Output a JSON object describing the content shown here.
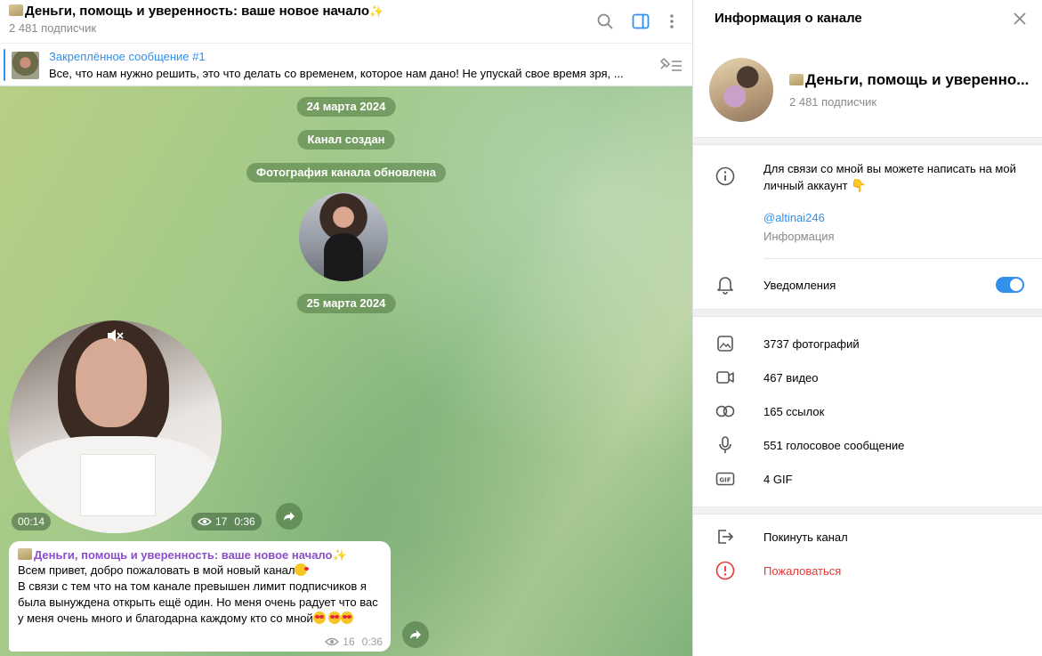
{
  "channel": {
    "title": "Деньги, помощь и уверенность: ваше новое начало",
    "subscribers": "2 481 подписчик"
  },
  "pinned": {
    "title": "Закреплённое сообщение #1",
    "text": "Все, что нам нужно решить, это что делать со временем, которое нам дано!  Не упускай свое время зря, ..."
  },
  "service": {
    "date1": "24 марта 2024",
    "created": "Канал создан",
    "photo_updated": "Фотография канала обновлена",
    "date2": "25 марта 2024"
  },
  "video_message": {
    "elapsed": "00:14",
    "views": "17",
    "time": "0:36"
  },
  "post": {
    "title": "Деньги, помощь и уверенность: ваше новое начало",
    "line1": "Всем привет, добро пожаловать в мой новый канал",
    "line2": "В связи с тем что на том канале превышен лимит подписчиков я была вынуждена открыть ещё один. Но меня очень радует что вас у меня очень много и благодарна каждому кто со мной",
    "views": "16",
    "time": "0:36"
  },
  "info_panel": {
    "header": "Информация о канале",
    "name": "Деньги, помощь и уверенно...",
    "subscribers": "2 481 подписчик",
    "about": "Для связи со мной вы можете написать на мой личный аккаунт",
    "username": "@altinai246",
    "username_caption": "Информация",
    "notifications": "Уведомления",
    "notifications_on": true,
    "media": {
      "photos": "3737 фотографий",
      "videos": "467 видео",
      "links": "165 ссылок",
      "voice": "551 голосовое сообщение",
      "gifs": "4 GIF"
    },
    "leave": "Покинуть канал",
    "report": "Пожаловаться"
  },
  "colors": {
    "accent": "#3390ec",
    "post_title": "#8a4fc9",
    "danger": "#e53935"
  },
  "icons": [
    "search-icon",
    "sidebar-toggle-icon",
    "more-icon",
    "pin-list-icon",
    "mute-icon",
    "share-icon",
    "eye-icon",
    "close-icon",
    "info-icon",
    "bell-icon",
    "photo-icon",
    "video-icon",
    "link-icon",
    "mic-icon",
    "gif-icon",
    "leave-icon",
    "report-icon"
  ]
}
